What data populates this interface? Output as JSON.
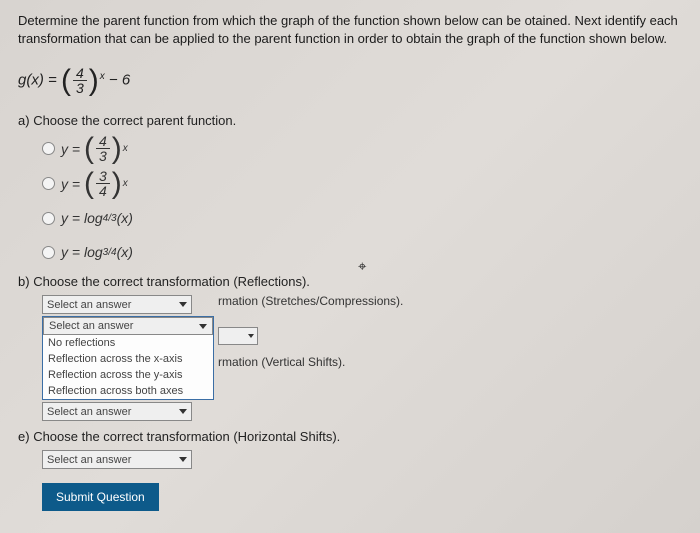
{
  "instructions": "Determine the parent function from which the graph of the function shown below can be otained. Next identify each transformation that can be applied to the parent function in order to obtain the graph of the function shown below.",
  "equation": {
    "lhs": "g(x) =",
    "num": "4",
    "den": "3",
    "exp": "x",
    "tail": "− 6"
  },
  "partA": {
    "label": "a)",
    "text": "Choose the correct parent function.",
    "options": [
      {
        "kind": "frac",
        "num": "4",
        "den": "3",
        "exp": "x"
      },
      {
        "kind": "frac",
        "num": "3",
        "den": "4",
        "exp": "x"
      },
      {
        "kind": "log",
        "sub": "4/3"
      },
      {
        "kind": "log",
        "sub": "3/4"
      }
    ]
  },
  "partB": {
    "label": "b)",
    "text": "Choose the correct transformation (Reflections).",
    "placeholder": "Select an answer",
    "dropdown": [
      "Select an answer",
      "No reflections",
      "Reflection across the x-axis",
      "Reflection across the y-axis",
      "Reflection across both axes"
    ]
  },
  "partC": {
    "suffix": "rmation (Stretches/Compressions)."
  },
  "partD": {
    "placeholder": "Select an answer",
    "suffix": "rmation (Vertical Shifts)."
  },
  "partE": {
    "label": "e)",
    "text": "Choose the correct transformation (Horizontal Shifts).",
    "placeholder": "Select an answer"
  },
  "submit": "Submit Question",
  "yeq": "y ="
}
